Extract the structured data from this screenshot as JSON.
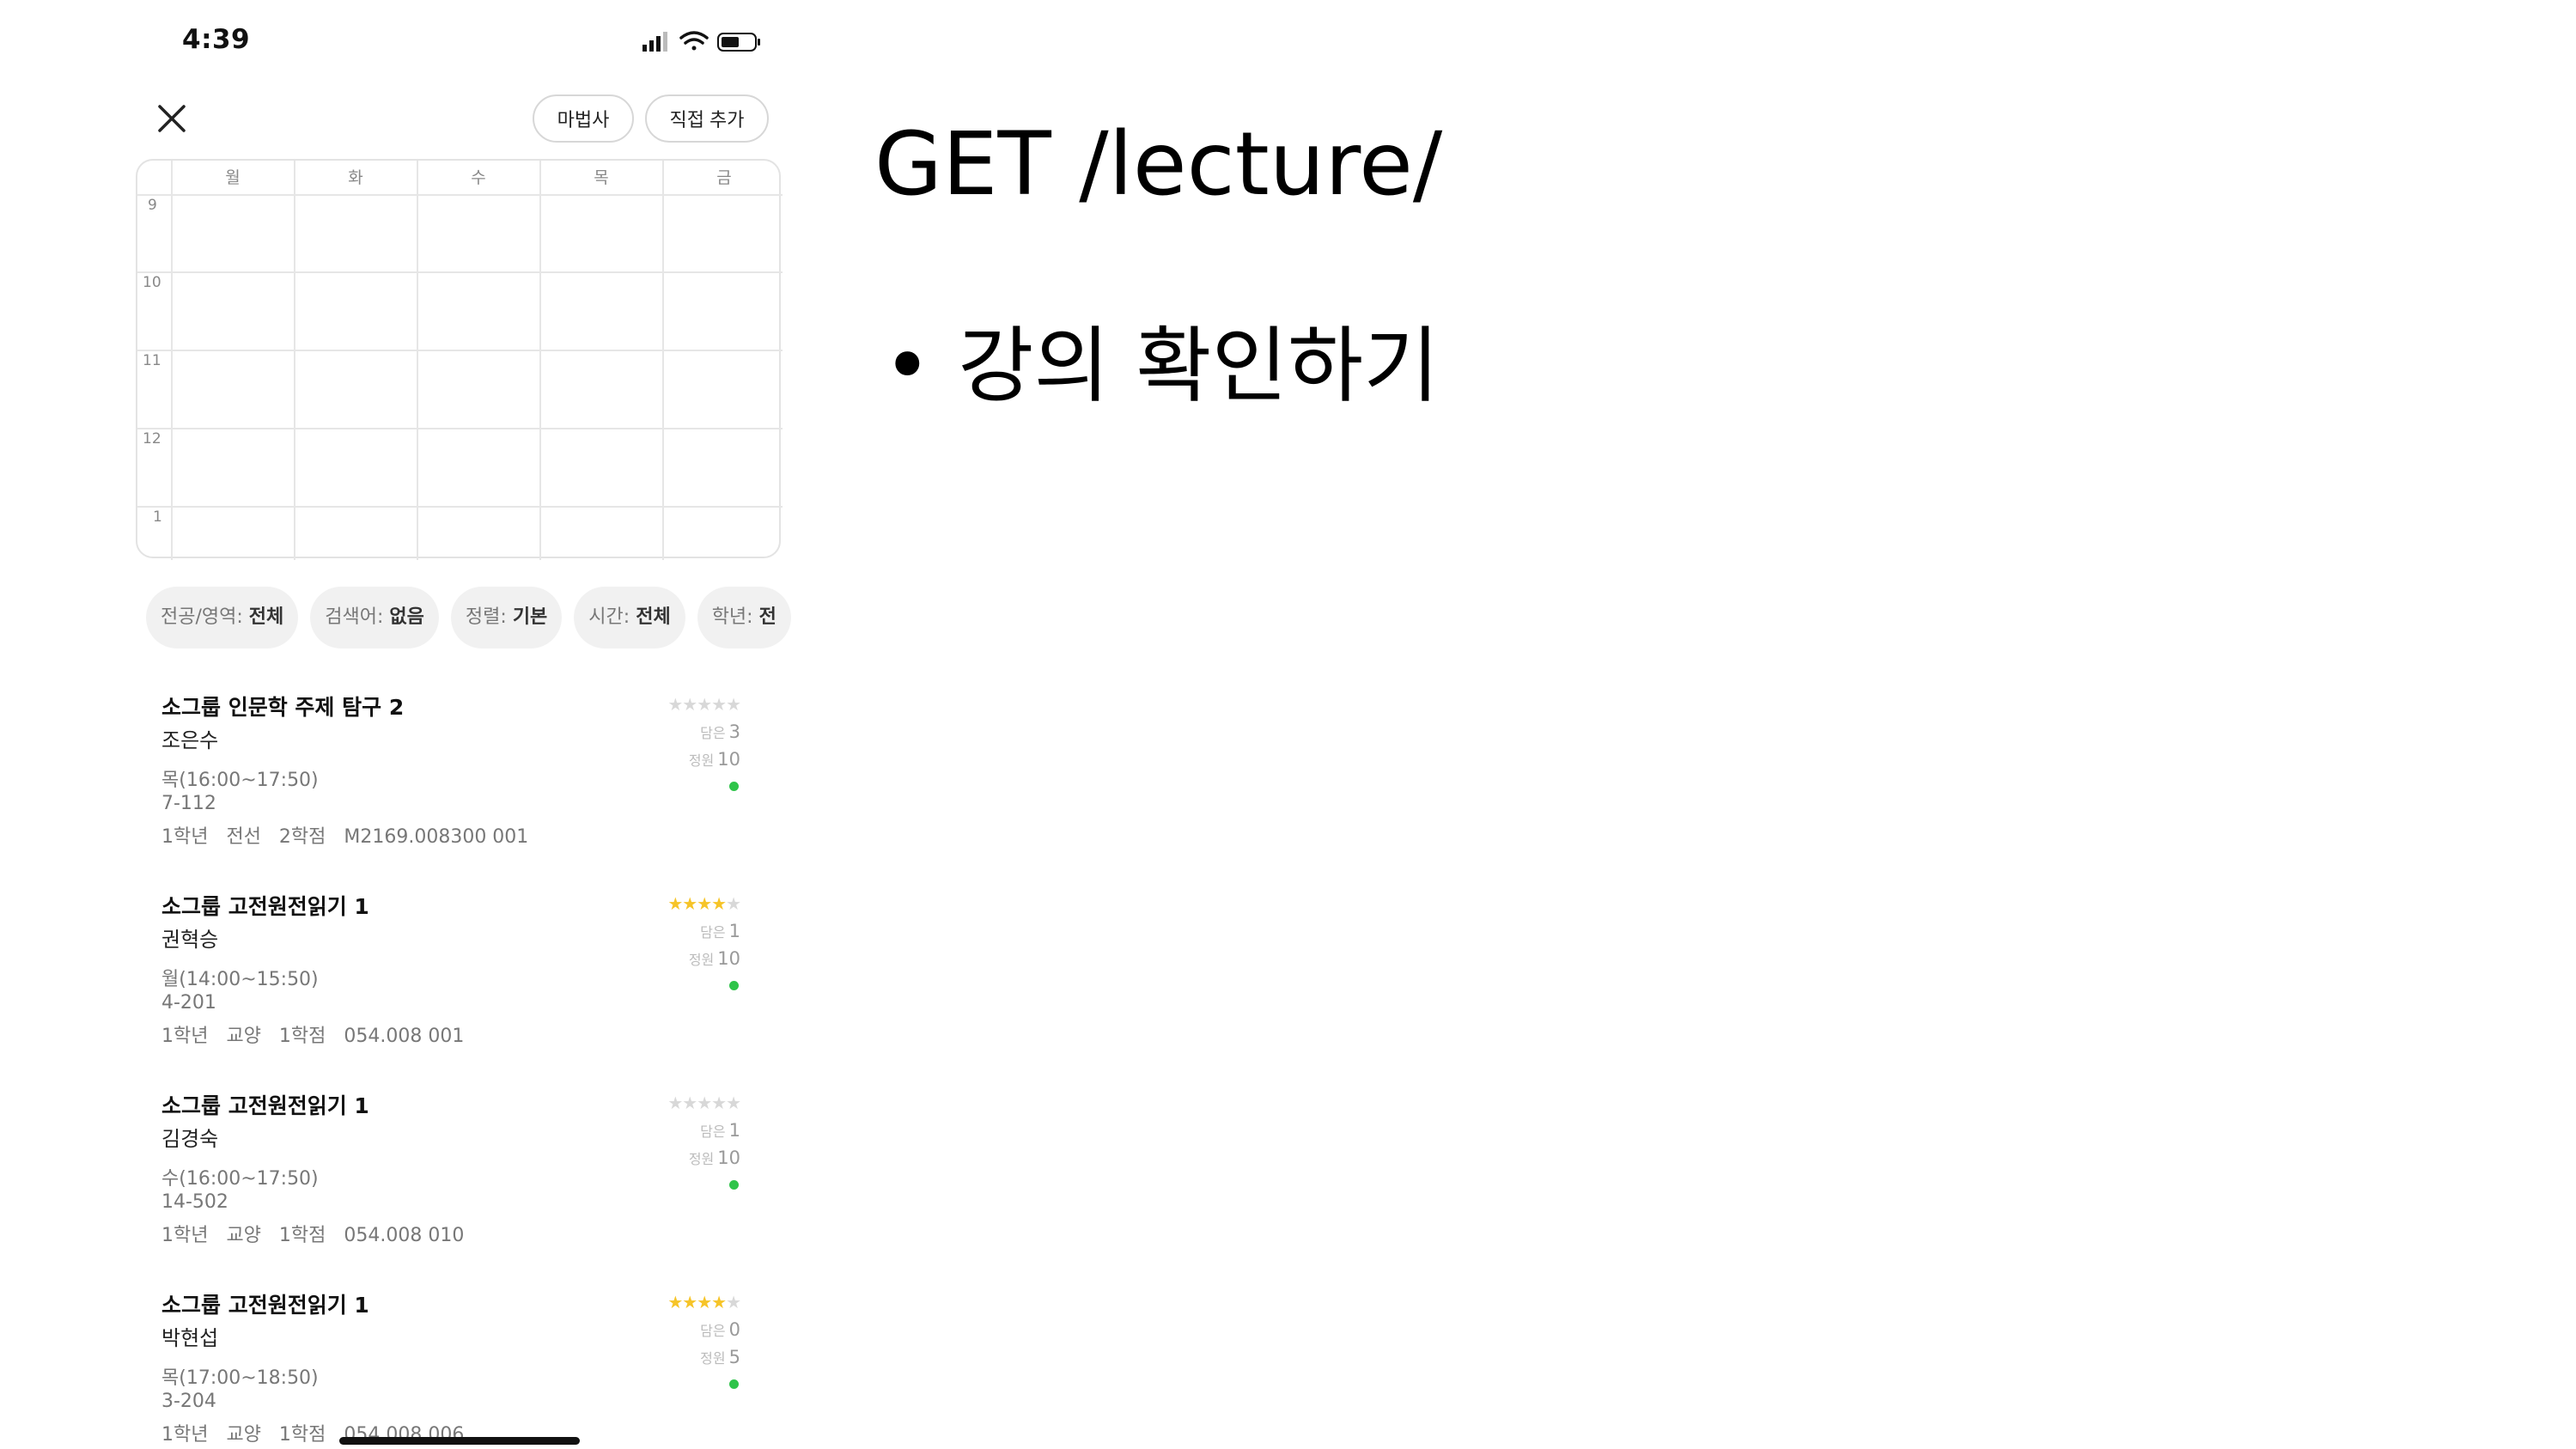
{
  "status_bar": {
    "time": "4:39"
  },
  "header": {
    "wizard_label": "마법사",
    "direct_add_label": "직접 추가"
  },
  "timetable": {
    "days": [
      "월",
      "화",
      "수",
      "목",
      "금"
    ],
    "hours": [
      "9",
      "10",
      "11",
      "12",
      "1"
    ]
  },
  "filters": [
    {
      "key": "전공/영역:",
      "value": "전체"
    },
    {
      "key": "검색어:",
      "value": "없음"
    },
    {
      "key": "정렬:",
      "value": "기본"
    },
    {
      "key": "시간:",
      "value": "전체"
    },
    {
      "key": "학년:",
      "value": "전"
    }
  ],
  "labels": {
    "enrolled": "담은",
    "capacity": "정원"
  },
  "courses": [
    {
      "title": "소그룹 인문학 주제 탐구 2",
      "professor": "조은수",
      "time": "목(16:00~17:50)",
      "room": "7-112",
      "info": "1학년   전선   2학점   M2169.008300 001",
      "rating": 0,
      "enrolled": "3",
      "capacity": "10"
    },
    {
      "title": "소그룹 고전원전읽기 1",
      "professor": "권혁승",
      "time": "월(14:00~15:50)",
      "room": "4-201",
      "info": "1학년   교양   1학점   054.008 001",
      "rating": 4,
      "enrolled": "1",
      "capacity": "10"
    },
    {
      "title": "소그룹 고전원전읽기 1",
      "professor": "김경숙",
      "time": "수(16:00~17:50)",
      "room": "14-502",
      "info": "1학년   교양   1학점   054.008 010",
      "rating": 0,
      "enrolled": "1",
      "capacity": "10"
    },
    {
      "title": "소그룹 고전원전읽기 1",
      "professor": "박현섭",
      "time": "목(17:00~18:50)",
      "room": "3-204",
      "info": "1학년   교양   1학점   054.008 006",
      "rating": 4,
      "enrolled": "0",
      "capacity": "5"
    }
  ],
  "slide": {
    "title": "GET /lecture/",
    "bullet": "• 강의 확인하기"
  },
  "colors": {
    "star_active": "#f6c428",
    "status_dot": "#2fc44a"
  }
}
